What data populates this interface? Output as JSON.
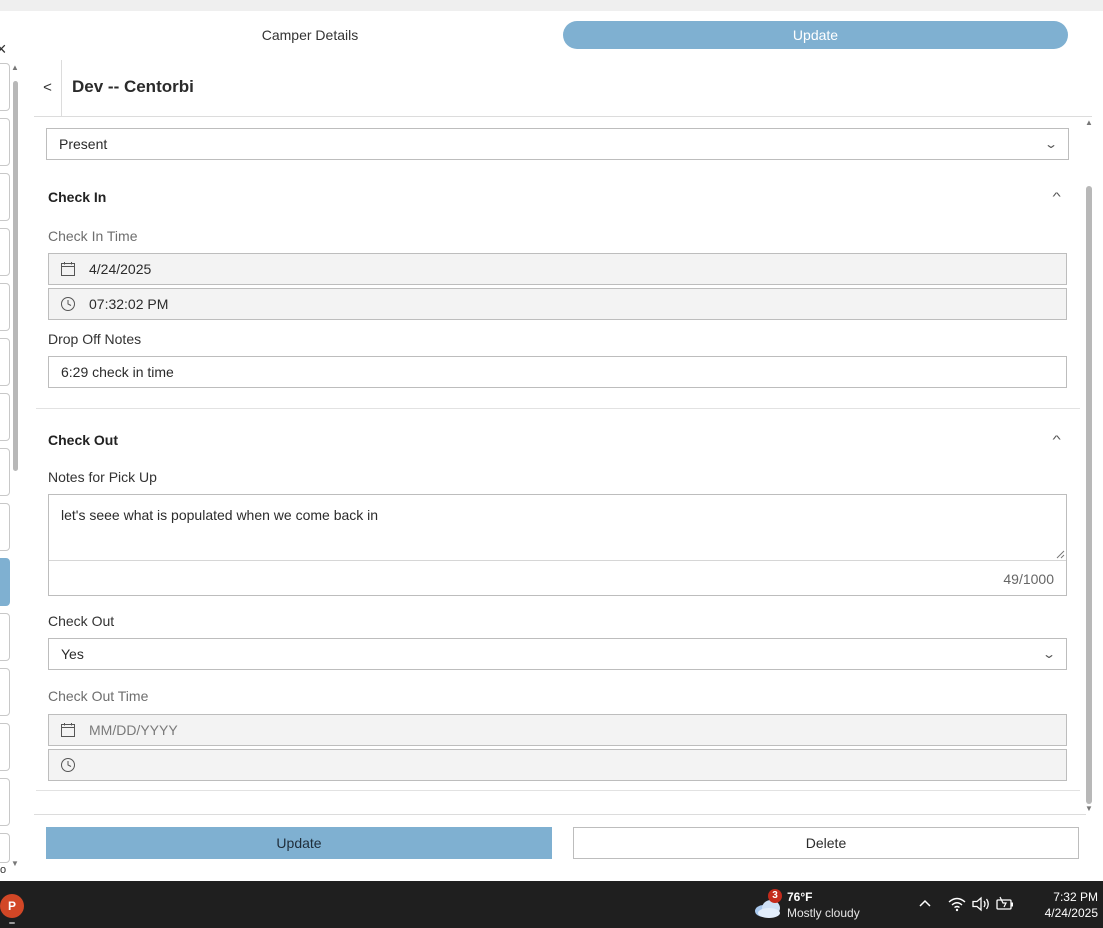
{
  "header": {
    "tab_details": "Camper Details",
    "tab_update": "Update",
    "back": "<",
    "title": "Dev -- Centorbi"
  },
  "left_rail": {
    "close": "×",
    "footer_glyph": "o"
  },
  "attendance": {
    "selected": "Present"
  },
  "check_in": {
    "section_title": "Check In",
    "time_label": "Check In Time",
    "date_value": "4/24/2025",
    "time_value": "07:32:02 PM",
    "notes_label": "Drop Off Notes",
    "notes_value": "6:29 check in time"
  },
  "check_out": {
    "section_title": "Check Out",
    "pickup_label": "Notes for Pick Up",
    "pickup_value": "let's seee what is populated when we come back in",
    "pickup_count": "49/1000",
    "checkout_label": "Check Out",
    "checkout_selected": "Yes",
    "time_label": "Check Out Time",
    "date_placeholder": "MM/DD/YYYY",
    "time_value": ""
  },
  "footer": {
    "update_label": "Update",
    "delete_label": "Delete"
  },
  "taskbar": {
    "app_letter": "P",
    "weather_badge": "3",
    "temperature": "76°F",
    "condition": "Mostly cloudy",
    "time": "7:32 PM",
    "date": "4/24/2025"
  },
  "colors": {
    "accent": "#7fb0d1",
    "taskbar": "#1f1f1f",
    "field_bg": "#f3f3f3"
  }
}
